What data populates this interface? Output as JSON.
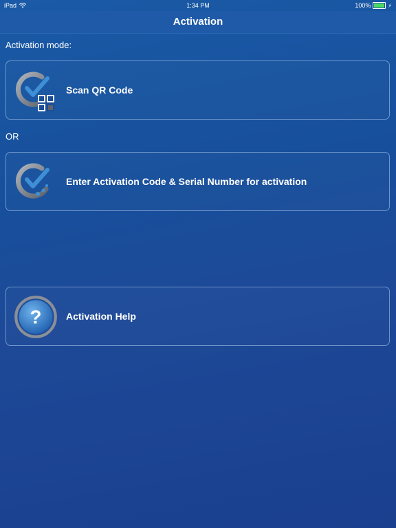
{
  "status_bar": {
    "device": "iPad",
    "time": "1:34 PM",
    "battery_percent": "100%",
    "battery_level": 1.0,
    "wifi_icon": "wifi-icon",
    "charging_icon": "bolt-icon"
  },
  "nav": {
    "title": "Activation"
  },
  "main": {
    "mode_label": "Activation mode:",
    "or_label": "OR",
    "options": [
      {
        "label": "Scan QR Code",
        "icon": "qr-check-icon"
      },
      {
        "label": "Enter Activation Code & Serial Number for activation",
        "icon": "check-icon"
      },
      {
        "label": "Activation Help",
        "icon": "help-icon"
      }
    ]
  },
  "colors": {
    "background_top": "#1a5aa6",
    "background_bottom": "#1a3f8e",
    "nav_bar": "#1e5aa8",
    "battery_fill": "#4cd964",
    "icon_check_blue": "#3f8fd6",
    "icon_ring_gray": "#8a8f98"
  }
}
